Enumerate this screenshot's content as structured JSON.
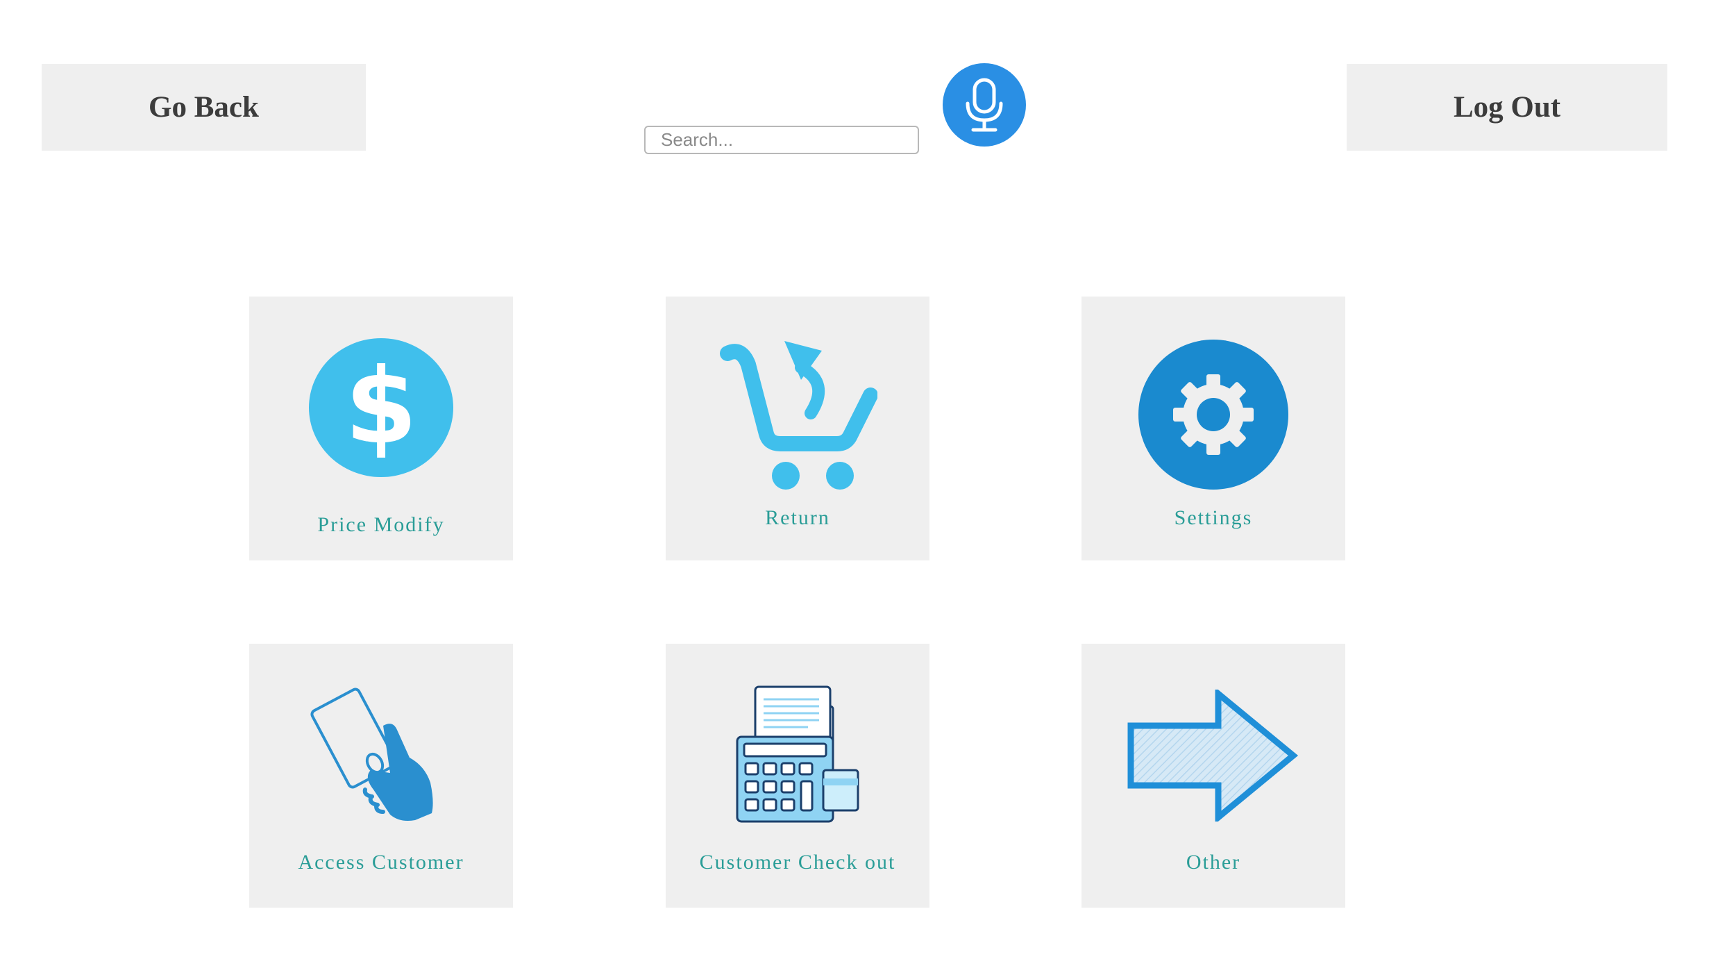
{
  "header": {
    "back_label": "Go Back",
    "logout_label": "Log Out",
    "search_placeholder": "Search...",
    "search_value": "",
    "mic_icon": "microphone-icon"
  },
  "tiles": [
    {
      "label": "Price Modify",
      "icon": "dollar-icon"
    },
    {
      "label": "Return",
      "icon": "cart-return-icon"
    },
    {
      "label": "Settings",
      "icon": "gear-icon"
    },
    {
      "label": "Access Customer",
      "icon": "hand-card-icon"
    },
    {
      "label": "Customer Check out",
      "icon": "cash-register-icon"
    },
    {
      "label": "Other",
      "icon": "arrow-right-icon"
    }
  ],
  "colors": {
    "accent_blue": "#2a8fe4",
    "light_blue": "#40bfec",
    "tile_bg": "#efefef",
    "label_teal": "#2a9d97"
  }
}
